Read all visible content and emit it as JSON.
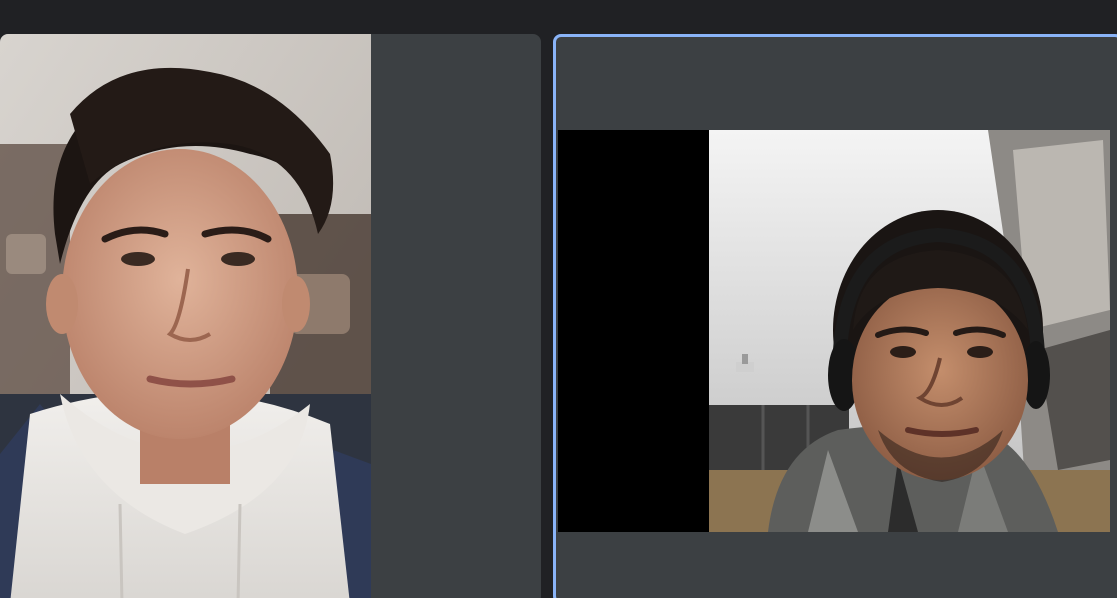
{
  "call": {
    "layout": "two-tile-grid",
    "active_speaker": "right",
    "colors": {
      "background": "#202124",
      "tile": "#3c4043",
      "active_border": "#8ab4f8"
    }
  },
  "participants": [
    {
      "position": "left",
      "video": "camera-feed-young-man-dark-curly-hair-white-hoodie"
    },
    {
      "position": "right",
      "video": "camera-feed-young-man-headphones-scarf-letterboxed"
    }
  ]
}
